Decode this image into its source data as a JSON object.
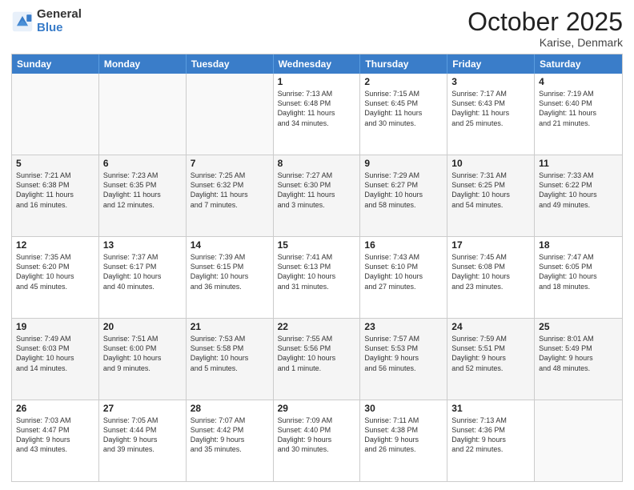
{
  "logo": {
    "general": "General",
    "blue": "Blue"
  },
  "title": "October 2025",
  "location": "Karise, Denmark",
  "days": [
    "Sunday",
    "Monday",
    "Tuesday",
    "Wednesday",
    "Thursday",
    "Friday",
    "Saturday"
  ],
  "weeks": [
    [
      {
        "day": "",
        "text": ""
      },
      {
        "day": "",
        "text": ""
      },
      {
        "day": "",
        "text": ""
      },
      {
        "day": "1",
        "text": "Sunrise: 7:13 AM\nSunset: 6:48 PM\nDaylight: 11 hours\nand 34 minutes."
      },
      {
        "day": "2",
        "text": "Sunrise: 7:15 AM\nSunset: 6:45 PM\nDaylight: 11 hours\nand 30 minutes."
      },
      {
        "day": "3",
        "text": "Sunrise: 7:17 AM\nSunset: 6:43 PM\nDaylight: 11 hours\nand 25 minutes."
      },
      {
        "day": "4",
        "text": "Sunrise: 7:19 AM\nSunset: 6:40 PM\nDaylight: 11 hours\nand 21 minutes."
      }
    ],
    [
      {
        "day": "5",
        "text": "Sunrise: 7:21 AM\nSunset: 6:38 PM\nDaylight: 11 hours\nand 16 minutes."
      },
      {
        "day": "6",
        "text": "Sunrise: 7:23 AM\nSunset: 6:35 PM\nDaylight: 11 hours\nand 12 minutes."
      },
      {
        "day": "7",
        "text": "Sunrise: 7:25 AM\nSunset: 6:32 PM\nDaylight: 11 hours\nand 7 minutes."
      },
      {
        "day": "8",
        "text": "Sunrise: 7:27 AM\nSunset: 6:30 PM\nDaylight: 11 hours\nand 3 minutes."
      },
      {
        "day": "9",
        "text": "Sunrise: 7:29 AM\nSunset: 6:27 PM\nDaylight: 10 hours\nand 58 minutes."
      },
      {
        "day": "10",
        "text": "Sunrise: 7:31 AM\nSunset: 6:25 PM\nDaylight: 10 hours\nand 54 minutes."
      },
      {
        "day": "11",
        "text": "Sunrise: 7:33 AM\nSunset: 6:22 PM\nDaylight: 10 hours\nand 49 minutes."
      }
    ],
    [
      {
        "day": "12",
        "text": "Sunrise: 7:35 AM\nSunset: 6:20 PM\nDaylight: 10 hours\nand 45 minutes."
      },
      {
        "day": "13",
        "text": "Sunrise: 7:37 AM\nSunset: 6:17 PM\nDaylight: 10 hours\nand 40 minutes."
      },
      {
        "day": "14",
        "text": "Sunrise: 7:39 AM\nSunset: 6:15 PM\nDaylight: 10 hours\nand 36 minutes."
      },
      {
        "day": "15",
        "text": "Sunrise: 7:41 AM\nSunset: 6:13 PM\nDaylight: 10 hours\nand 31 minutes."
      },
      {
        "day": "16",
        "text": "Sunrise: 7:43 AM\nSunset: 6:10 PM\nDaylight: 10 hours\nand 27 minutes."
      },
      {
        "day": "17",
        "text": "Sunrise: 7:45 AM\nSunset: 6:08 PM\nDaylight: 10 hours\nand 23 minutes."
      },
      {
        "day": "18",
        "text": "Sunrise: 7:47 AM\nSunset: 6:05 PM\nDaylight: 10 hours\nand 18 minutes."
      }
    ],
    [
      {
        "day": "19",
        "text": "Sunrise: 7:49 AM\nSunset: 6:03 PM\nDaylight: 10 hours\nand 14 minutes."
      },
      {
        "day": "20",
        "text": "Sunrise: 7:51 AM\nSunset: 6:00 PM\nDaylight: 10 hours\nand 9 minutes."
      },
      {
        "day": "21",
        "text": "Sunrise: 7:53 AM\nSunset: 5:58 PM\nDaylight: 10 hours\nand 5 minutes."
      },
      {
        "day": "22",
        "text": "Sunrise: 7:55 AM\nSunset: 5:56 PM\nDaylight: 10 hours\nand 1 minute."
      },
      {
        "day": "23",
        "text": "Sunrise: 7:57 AM\nSunset: 5:53 PM\nDaylight: 9 hours\nand 56 minutes."
      },
      {
        "day": "24",
        "text": "Sunrise: 7:59 AM\nSunset: 5:51 PM\nDaylight: 9 hours\nand 52 minutes."
      },
      {
        "day": "25",
        "text": "Sunrise: 8:01 AM\nSunset: 5:49 PM\nDaylight: 9 hours\nand 48 minutes."
      }
    ],
    [
      {
        "day": "26",
        "text": "Sunrise: 7:03 AM\nSunset: 4:47 PM\nDaylight: 9 hours\nand 43 minutes."
      },
      {
        "day": "27",
        "text": "Sunrise: 7:05 AM\nSunset: 4:44 PM\nDaylight: 9 hours\nand 39 minutes."
      },
      {
        "day": "28",
        "text": "Sunrise: 7:07 AM\nSunset: 4:42 PM\nDaylight: 9 hours\nand 35 minutes."
      },
      {
        "day": "29",
        "text": "Sunrise: 7:09 AM\nSunset: 4:40 PM\nDaylight: 9 hours\nand 30 minutes."
      },
      {
        "day": "30",
        "text": "Sunrise: 7:11 AM\nSunset: 4:38 PM\nDaylight: 9 hours\nand 26 minutes."
      },
      {
        "day": "31",
        "text": "Sunrise: 7:13 AM\nSunset: 4:36 PM\nDaylight: 9 hours\nand 22 minutes."
      },
      {
        "day": "",
        "text": ""
      }
    ]
  ]
}
